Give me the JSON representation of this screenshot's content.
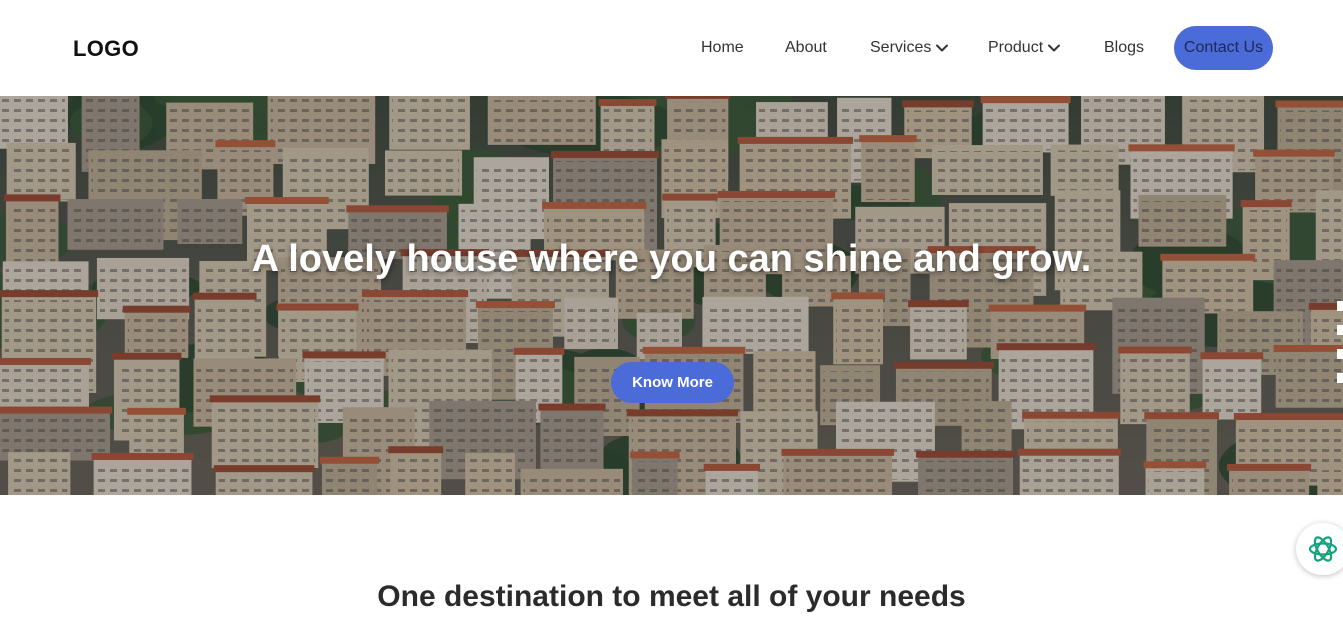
{
  "header": {
    "logo": "LOGO",
    "nav": [
      {
        "label": "Home"
      },
      {
        "label": "About"
      },
      {
        "label": "Services",
        "has_dropdown": true
      },
      {
        "label": "Product",
        "has_dropdown": true
      },
      {
        "label": "Blogs"
      }
    ],
    "contact_label": "Contact Us"
  },
  "hero": {
    "title": "A lovely house where you can shine and grow.",
    "subtitle": "",
    "cta_label": "Know More"
  },
  "section": {
    "title": "One destination to meet all of your needs"
  },
  "icons": {
    "dropdown": "chevron-down-icon",
    "assistant": "openai-logo-icon"
  },
  "colors": {
    "accent": "#4a6bd8",
    "assistant_icon": "#13a37f"
  }
}
